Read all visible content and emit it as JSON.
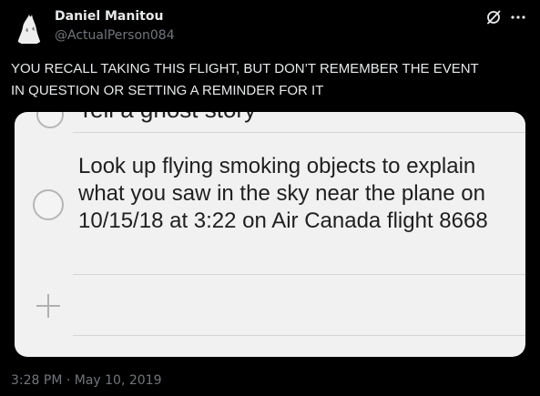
{
  "author": {
    "display_name": "Daniel Manitou",
    "handle": "@ActualPerson084"
  },
  "tweet": {
    "text": "YOU RECALL TAKING THIS FLIGHT, BUT DON’T REMEMBER THE EVENT\nIN QUESTION OR SETTING A REMINDER FOR IT",
    "timestamp": "3:28 PM · May 10, 2019"
  },
  "media": {
    "reminders": [
      {
        "text": "Tell a ghost story",
        "completed": false
      },
      {
        "text": "Look up flying smoking objects to explain what you saw in the sky near the plane on 10/15/18 at 3:22 on Air Canada flight 8668",
        "completed": false
      }
    ],
    "add_icon": "plus-icon"
  },
  "icons": {
    "grok": "grok-icon",
    "more": "more-icon"
  }
}
